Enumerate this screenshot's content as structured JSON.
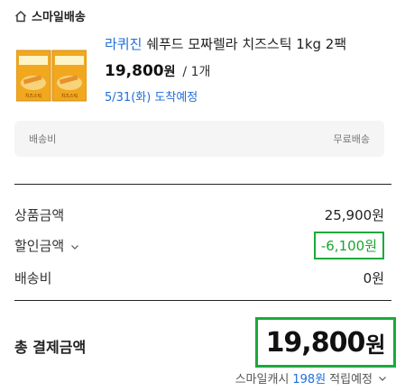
{
  "header": {
    "label": "스마일배송",
    "icon": "home-icon"
  },
  "product": {
    "brand": "라퀴진",
    "name": "쉐푸드 모짜렐라 치즈스틱 1kg 2팩",
    "price": "19,800",
    "price_unit": "원",
    "qty": "/ 1개",
    "eta": "5/31(화) 도착예정",
    "thumb_badge": "치즈스틱"
  },
  "shipping_box": {
    "label": "배송비",
    "value": "무료배송"
  },
  "summary": {
    "subtotal_label": "상품금액",
    "subtotal_value": "25,900원",
    "discount_label": "할인금액",
    "discount_value": "-6,100원",
    "shipping_label": "배송비",
    "shipping_value": "0원"
  },
  "total": {
    "label": "총 결제금액",
    "amount": "19,800",
    "unit": "원"
  },
  "cash": {
    "prefix": "스마일캐시",
    "points": "198원",
    "suffix": "적립예정"
  },
  "colors": {
    "accent_blue": "#1e6fd9",
    "highlight_green": "#1aaa3a"
  }
}
